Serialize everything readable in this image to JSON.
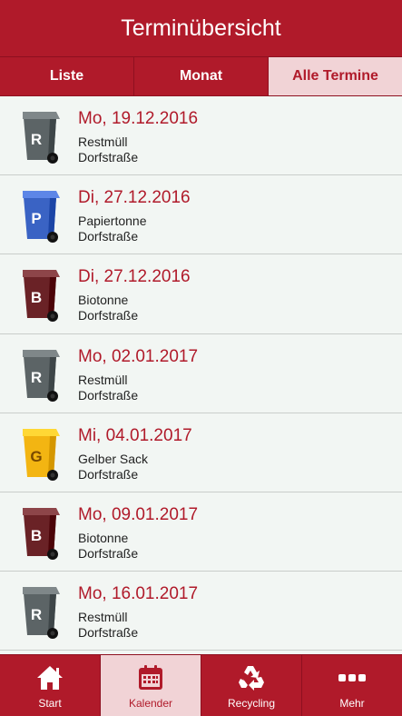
{
  "header": {
    "title": "Terminübersicht"
  },
  "tabs": [
    {
      "label": "Liste",
      "active": false
    },
    {
      "label": "Monat",
      "active": false
    },
    {
      "label": "Alle Termine",
      "active": true
    }
  ],
  "bin_colors": {
    "R": "#5c6466",
    "P": "#3a63c4",
    "B": "#6a2226",
    "G": "#f3b512"
  },
  "entries": [
    {
      "date": "Mo, 19.12.2016",
      "type": "Restmüll",
      "street": "Dorfstraße",
      "bin_letter": "R",
      "icon": "restmuell-bin-icon"
    },
    {
      "date": "Di, 27.12.2016",
      "type": "Papiertonne",
      "street": "Dorfstraße",
      "bin_letter": "P",
      "icon": "papiertonne-bin-icon"
    },
    {
      "date": "Di, 27.12.2016",
      "type": "Biotonne",
      "street": "Dorfstraße",
      "bin_letter": "B",
      "icon": "biotonne-bin-icon"
    },
    {
      "date": "Mo, 02.01.2017",
      "type": "Restmüll",
      "street": "Dorfstraße",
      "bin_letter": "R",
      "icon": "restmuell-bin-icon"
    },
    {
      "date": "Mi, 04.01.2017",
      "type": "Gelber Sack",
      "street": "Dorfstraße",
      "bin_letter": "G",
      "icon": "gelber-sack-bin-icon"
    },
    {
      "date": "Mo, 09.01.2017",
      "type": "Biotonne",
      "street": "Dorfstraße",
      "bin_letter": "B",
      "icon": "biotonne-bin-icon"
    },
    {
      "date": "Mo, 16.01.2017",
      "type": "Restmüll",
      "street": "Dorfstraße",
      "bin_letter": "R",
      "icon": "restmuell-bin-icon"
    }
  ],
  "bottom_nav": [
    {
      "label": "Start",
      "icon": "home-icon",
      "active": false
    },
    {
      "label": "Kalender",
      "icon": "calendar-icon",
      "active": true
    },
    {
      "label": "Recycling",
      "icon": "recycling-icon",
      "active": false
    },
    {
      "label": "Mehr",
      "icon": "more-icon",
      "active": false
    }
  ],
  "colors": {
    "accent": "#b01a2a",
    "active_tab_bg": "#f1d3d6",
    "list_bg": "#f2f6f3"
  }
}
